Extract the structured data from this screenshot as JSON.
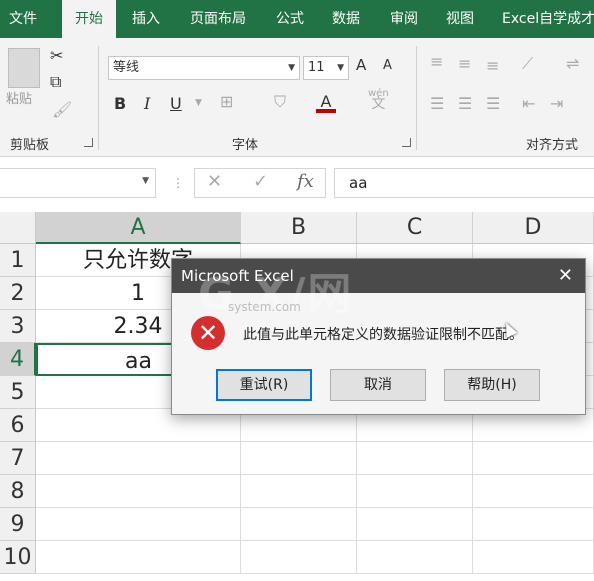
{
  "ribbon_tabs": [
    "文件",
    "开始",
    "插入",
    "页面布局",
    "公式",
    "数据",
    "审阅",
    "视图",
    "Excel自学成才"
  ],
  "active_tab": "开始",
  "clipboard": {
    "paste_label": "粘贴",
    "group_label": "剪贴板"
  },
  "font": {
    "name": "等线",
    "size": "11",
    "group_label": "字体",
    "bold": "B",
    "italic": "I",
    "underline": "U",
    "grow": "A",
    "shrink": "A",
    "font_color": "A",
    "wen": "wén",
    "wen_char": "文"
  },
  "alignment": {
    "group_label": "对齐方式"
  },
  "formula_bar": {
    "fx": "fx",
    "cancel": "✕",
    "enter": "✓",
    "value": "aa",
    "name_box": ""
  },
  "columns": [
    "A",
    "B",
    "C",
    "D"
  ],
  "active_column": "A",
  "rows": [
    "1",
    "2",
    "3",
    "4",
    "5",
    "6",
    "7",
    "8",
    "9",
    "10"
  ],
  "active_row": "4",
  "cells": {
    "A1": "只允许数字",
    "A2": "1",
    "A3": "2.34",
    "A4": "aa"
  },
  "dialog": {
    "title": "Microsoft Excel",
    "close": "✕",
    "icon": "error-icon",
    "message": "此值与此单元格定义的数据验证限制不匹配。",
    "buttons": [
      "重试(R)",
      "取消",
      "帮助(H)"
    ]
  },
  "watermark": {
    "main": "G X/网",
    "sub": "system.com"
  },
  "colors": {
    "excel_green": "#217346",
    "dialog_title": "#4a4a4a",
    "error_red": "#d32f2f",
    "default_button_border": "#0078d7"
  }
}
